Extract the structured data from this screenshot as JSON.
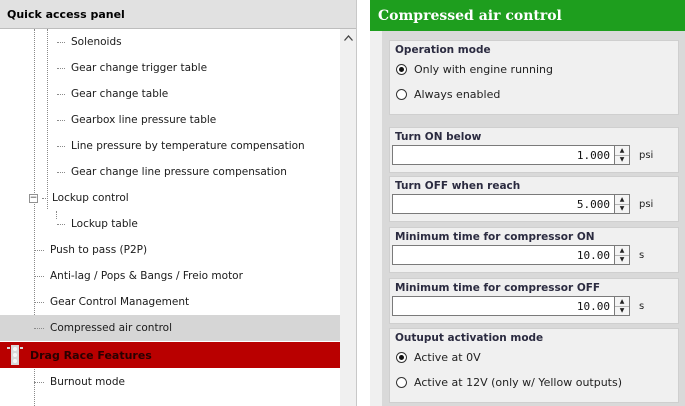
{
  "left_panel": {
    "title": "Quick access panel",
    "tree": [
      {
        "label": "Solenoids",
        "depth": 2
      },
      {
        "label": "Gear change trigger table",
        "depth": 2
      },
      {
        "label": "Gear change table",
        "depth": 2
      },
      {
        "label": "Gearbox line pressure table",
        "depth": 2
      },
      {
        "label": "Line pressure by temperature compensation",
        "depth": 2
      },
      {
        "label": "Gear change line pressure compensation",
        "depth": 2
      },
      {
        "label": "Lockup control",
        "depth": 1,
        "expander": "−"
      },
      {
        "label": "Lockup table",
        "depth": 2
      },
      {
        "label": "Push to pass (P2P)",
        "depth": 1
      },
      {
        "label": "Anti-lag / Pops & Bangs / Freio motor",
        "depth": 1
      },
      {
        "label": "Gear Control Management",
        "depth": 1
      },
      {
        "label": "Compressed air control",
        "depth": 1,
        "selected": true
      },
      {
        "label": "Drag Race Features",
        "category": true
      },
      {
        "label": "Burnout mode",
        "depth": 1
      }
    ]
  },
  "right_panel": {
    "title": "Compressed air control",
    "operation_mode": {
      "title": "Operation mode",
      "options": [
        "Only with engine running",
        "Always enabled"
      ],
      "selected": 0
    },
    "turn_on": {
      "title": "Turn ON below",
      "value": "1.000",
      "unit": "psi"
    },
    "turn_off": {
      "title": "Turn OFF when reach",
      "value": "5.000",
      "unit": "psi"
    },
    "min_on": {
      "title": "Minimum time for compressor ON",
      "value": "10.00",
      "unit": "s"
    },
    "min_off": {
      "title": "Minimum time for compressor OFF",
      "value": "10.00",
      "unit": "s"
    },
    "output_mode": {
      "title": "Outuput activation mode",
      "options": [
        "Active at 0V",
        "Active at 12V (only w/ Yellow outputs)"
      ],
      "selected": 0
    }
  },
  "colors": {
    "header_green": "#1e9e1e",
    "category_red": "#b90000",
    "selected_row": "#d6d6d6"
  },
  "icons": {
    "scroll_up": "chevron-up-icon",
    "spin": "spin-up-down-icon",
    "category": "drag-strip-light-icon"
  }
}
